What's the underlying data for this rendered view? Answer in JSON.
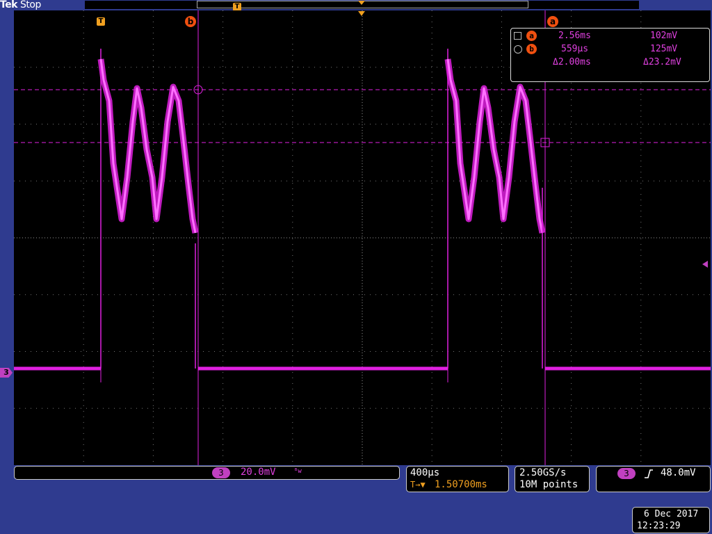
{
  "header": {
    "brand": "Tek",
    "status": "Stop"
  },
  "trigger_marker": "T",
  "cursors": {
    "a_label": "a",
    "b_label": "b"
  },
  "readout": {
    "a": {
      "time": "2.56ms",
      "volt": "102mV"
    },
    "b": {
      "time": "559µs",
      "volt": "125mV"
    },
    "delta": {
      "time": "Δ2.00ms",
      "volt": "Δ23.2mV"
    }
  },
  "channel": {
    "number": "3",
    "scale": "20.0mV",
    "bandwidth_symbol": "ᴮw",
    "color": "#e020e0"
  },
  "timebase": {
    "scale": "400µs",
    "trigger_icon": "T→▼",
    "position": "1.50700ms"
  },
  "acquisition": {
    "sample_rate": "2.50GS/s",
    "record_length": "10M points"
  },
  "trigger": {
    "source": "3",
    "slope_icon": "rising-edge-icon",
    "level": "48.0mV"
  },
  "datetime": {
    "date": "6 Dec 2017",
    "time": "12:23:29"
  },
  "colors": {
    "background": "#2f3b8f",
    "trace": "#e020e0",
    "cursor_marker": "#f05010",
    "trigger_marker": "#f0a020"
  }
}
